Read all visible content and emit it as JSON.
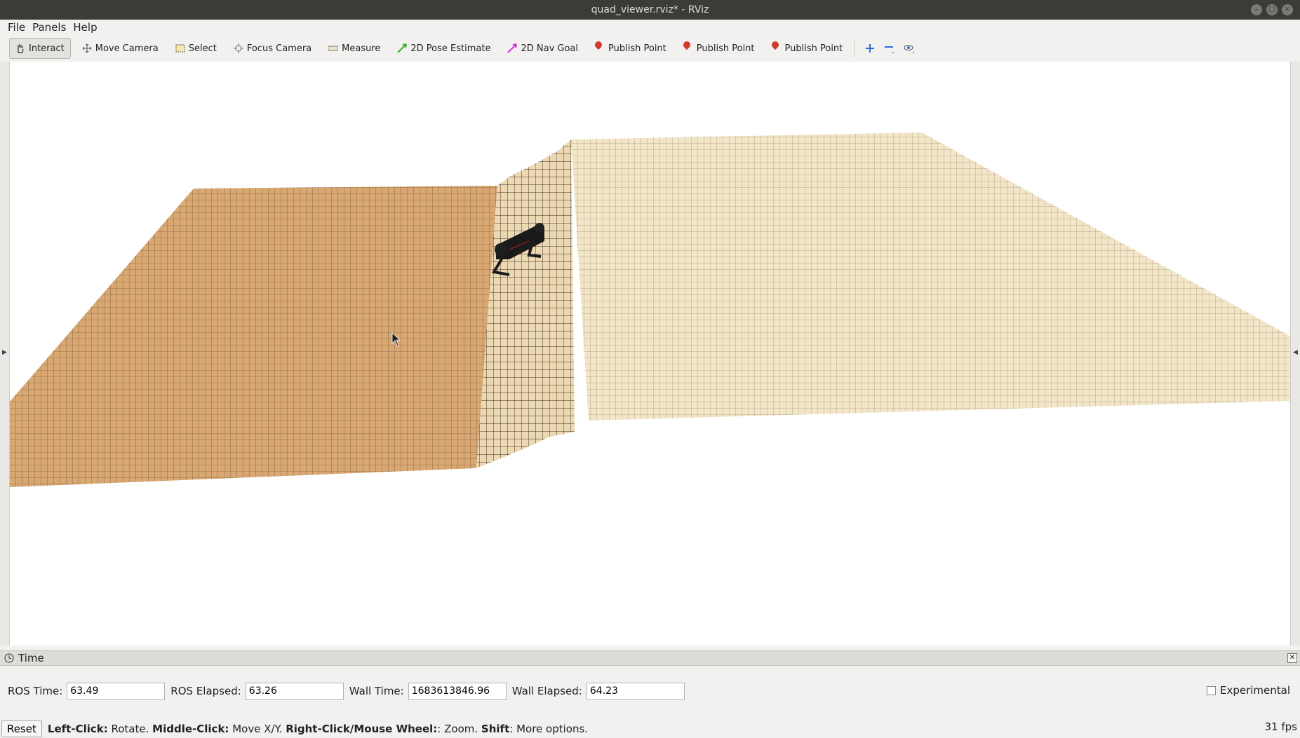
{
  "window": {
    "title": "quad_viewer.rviz* - RViz"
  },
  "menu": {
    "file": "File",
    "panels": "Panels",
    "help": "Help"
  },
  "toolbar": {
    "interact": "Interact",
    "move_camera": "Move Camera",
    "select": "Select",
    "focus_camera": "Focus Camera",
    "measure": "Measure",
    "pose_estimate": "2D Pose Estimate",
    "nav_goal": "2D Nav Goal",
    "publish_point_1": "Publish Point",
    "publish_point_2": "Publish Point",
    "publish_point_3": "Publish Point"
  },
  "time_panel": {
    "title": "Time",
    "ros_time_label": "ROS Time:",
    "ros_time": "63.49",
    "ros_elapsed_label": "ROS Elapsed:",
    "ros_elapsed": "63.26",
    "wall_time_label": "Wall Time:",
    "wall_time": "1683613846.96",
    "wall_elapsed_label": "Wall Elapsed:",
    "wall_elapsed": "64.23",
    "experimental_label": "Experimental"
  },
  "status": {
    "reset": "Reset",
    "left_click": "Left-Click:",
    "left_click_action": "Rotate.",
    "middle_click": "Middle-Click:",
    "middle_click_action": "Move X/Y.",
    "right_click": "Right-Click/Mouse Wheel:",
    "right_click_action": ": Zoom.",
    "shift": "Shift",
    "shift_action": ": More options.",
    "fps": "31 fps"
  },
  "colors": {
    "terrain_low": "#d9a872",
    "terrain_high": "#f3e6c8",
    "robot": "#1a1a1a"
  }
}
